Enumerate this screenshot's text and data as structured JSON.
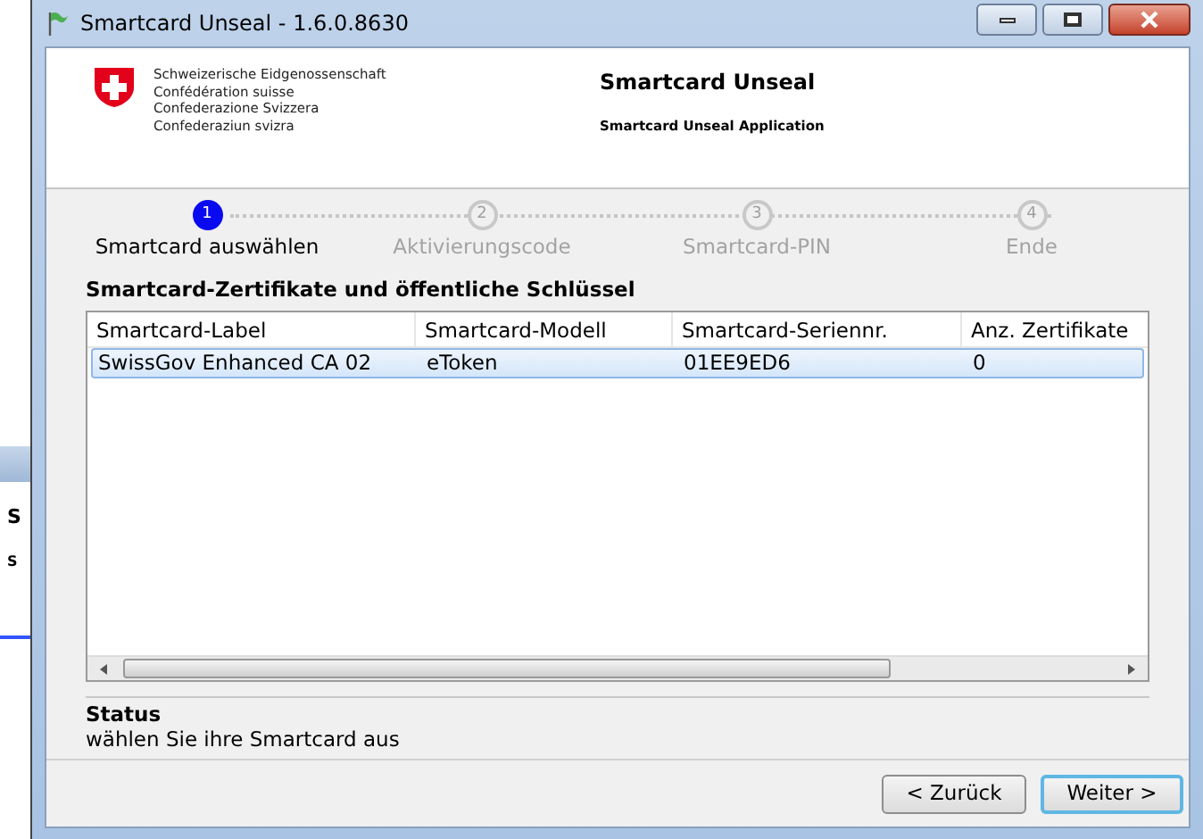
{
  "background_window": {
    "texts": [
      "S",
      "S"
    ]
  },
  "window": {
    "title": "Smartcard Unseal - 1.6.0.8630"
  },
  "header": {
    "org_lines": [
      "Schweizerische Eidgenossenschaft",
      "Confédération suisse",
      "Confederazione Svizzera",
      "Confederaziun svizra"
    ],
    "title": "Smartcard Unseal",
    "subtitle": "Smartcard Unseal Application"
  },
  "steps": [
    {
      "number": "1",
      "label": "Smartcard auswählen",
      "selected": true
    },
    {
      "number": "2",
      "label": "Aktivierungscode",
      "selected": false
    },
    {
      "number": "3",
      "label": "Smartcard-PIN",
      "selected": false
    },
    {
      "number": "4",
      "label": "Ende",
      "selected": false
    }
  ],
  "section_title": "Smartcard-Zertifikate und öffentliche Schlüssel",
  "table": {
    "columns": [
      "Smartcard-Label",
      "Smartcard-Modell",
      "Smartcard-Seriennr.",
      "Anz. Zertifikate"
    ],
    "rows": [
      {
        "cells": [
          "SwissGov Enhanced CA 02",
          "eToken",
          "01EE9ED6",
          "0"
        ],
        "selected": true
      }
    ]
  },
  "status": {
    "label": "Status",
    "text": "wählen Sie ihre Smartcard aus"
  },
  "buttons": [
    {
      "label": "< Zurück",
      "default": false
    },
    {
      "label": "Weiter >",
      "default": true
    }
  ]
}
